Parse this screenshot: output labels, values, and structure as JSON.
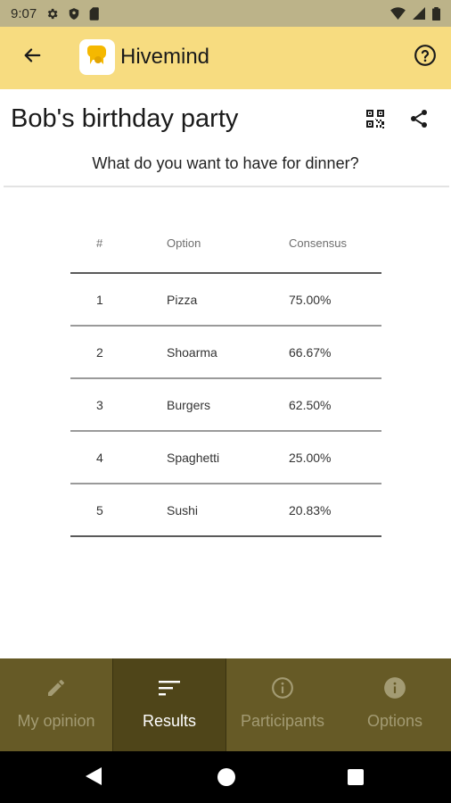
{
  "status_bar": {
    "time": "9:07",
    "left_icons": [
      "settings-icon",
      "shield-icon",
      "sd-card-icon"
    ],
    "right_icons": [
      "wifi-icon",
      "cellular-icon",
      "battery-icon"
    ]
  },
  "app_bar": {
    "title": "Hivemind",
    "back_icon": "arrow-back-icon",
    "help_icon": "help-icon"
  },
  "page": {
    "title": "Bob's birthday party",
    "question": "What do you want to have for dinner?"
  },
  "table": {
    "headers": {
      "rank": "#",
      "option": "Option",
      "consensus": "Consensus"
    },
    "rows": [
      {
        "rank": "1",
        "option": "Pizza",
        "consensus": "75.00%"
      },
      {
        "rank": "2",
        "option": "Shoarma",
        "consensus": "66.67%"
      },
      {
        "rank": "3",
        "option": "Burgers",
        "consensus": "62.50%"
      },
      {
        "rank": "4",
        "option": "Spaghetti",
        "consensus": "25.00%"
      },
      {
        "rank": "5",
        "option": "Sushi",
        "consensus": "20.83%"
      }
    ]
  },
  "bottom_nav": {
    "tabs": [
      {
        "label": "My opinion",
        "icon": "pencil-icon",
        "active": false
      },
      {
        "label": "Results",
        "icon": "sort-icon",
        "active": true
      },
      {
        "label": "Participants",
        "icon": "info-outline-icon",
        "active": false
      },
      {
        "label": "Options",
        "icon": "info-filled-icon",
        "active": false
      }
    ]
  },
  "colors": {
    "app_bar": "#f7dc80",
    "status_bar": "#bcb389",
    "bottom_nav": "#665a26",
    "bottom_nav_active": "#4f4519",
    "logo_accent": "#f5b800"
  }
}
